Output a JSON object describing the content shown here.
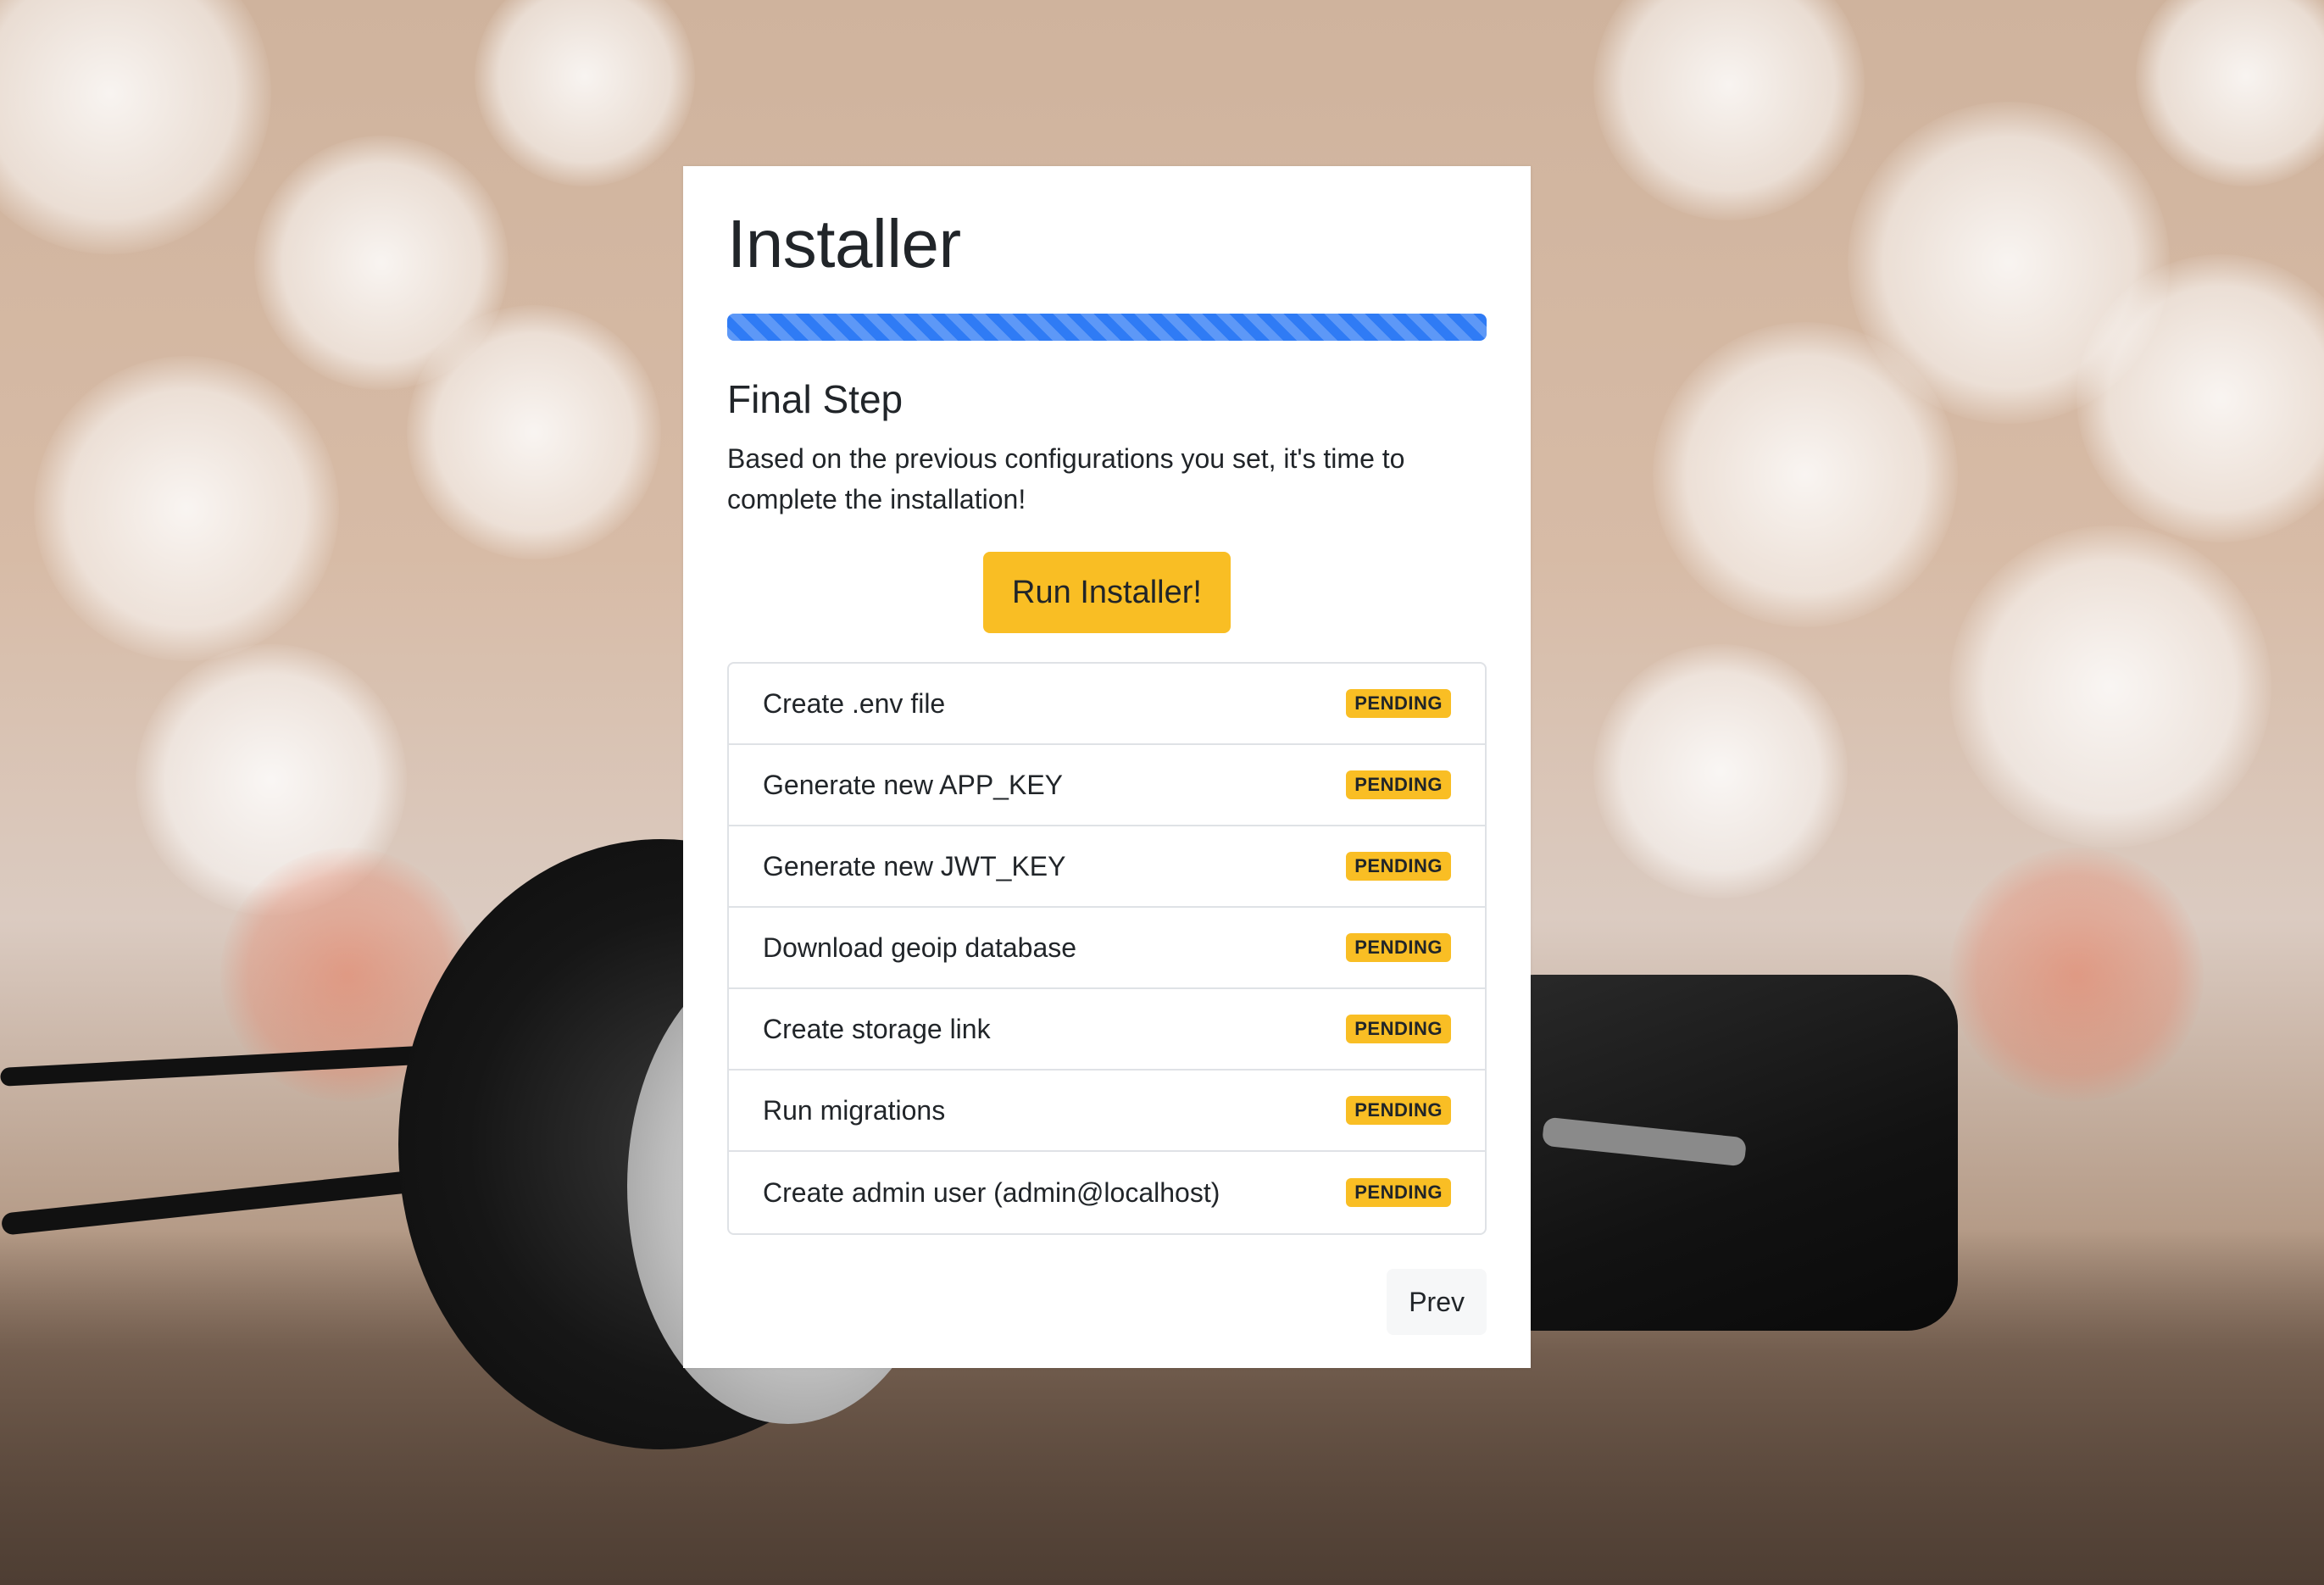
{
  "installer": {
    "title": "Installer",
    "progress_fraction": 1.0,
    "progress_color": "#2f7bf5",
    "step_title": "Final Step",
    "description": "Based on the previous configurations you set, it's time to complete the installation!",
    "run_button_label": "Run Installer!",
    "accent_color": "#f9be24",
    "tasks": [
      {
        "label": "Create .env file",
        "status": "PENDING"
      },
      {
        "label": "Generate new APP_KEY",
        "status": "PENDING"
      },
      {
        "label": "Generate new JWT_KEY",
        "status": "PENDING"
      },
      {
        "label": "Download geoip database",
        "status": "PENDING"
      },
      {
        "label": "Create storage link",
        "status": "PENDING"
      },
      {
        "label": "Run migrations",
        "status": "PENDING"
      },
      {
        "label": "Create admin user (admin@localhost)",
        "status": "PENDING"
      }
    ],
    "prev_button_label": "Prev"
  }
}
